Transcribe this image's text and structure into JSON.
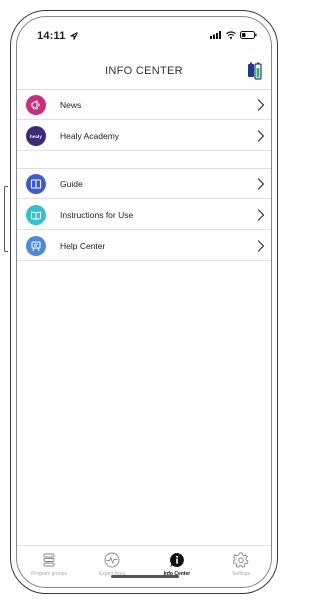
{
  "status": {
    "time": "14:11"
  },
  "header": {
    "title": "INFO CENTER"
  },
  "menu": [
    {
      "id": "news",
      "label": "News",
      "icon": "megaphone-icon",
      "color": "#c8307f"
    },
    {
      "id": "academy",
      "label": "Healy Academy",
      "icon": "healy-logo-icon",
      "color": "#3c2a7a",
      "logo_text": "healy"
    },
    {
      "id": "guide",
      "label": "Guide",
      "icon": "book-icon",
      "color": "#3b5fd0"
    },
    {
      "id": "instructions",
      "label": "Instructions for Use",
      "icon": "open-book-icon",
      "color": "#2ec3cf"
    },
    {
      "id": "help",
      "label": "Help Center",
      "icon": "help-board-icon",
      "color": "#4b8ad9"
    }
  ],
  "tabs": [
    {
      "id": "program-groups",
      "label": "Program groups",
      "icon": "list-icon",
      "active": false
    },
    {
      "id": "expert-area",
      "label": "Expert Area",
      "icon": "pulse-icon",
      "active": false
    },
    {
      "id": "info-center",
      "label": "Info Center",
      "icon": "info-bubble-icon",
      "active": true
    },
    {
      "id": "settings",
      "label": "Settings",
      "icon": "gear-icon",
      "active": false
    }
  ]
}
